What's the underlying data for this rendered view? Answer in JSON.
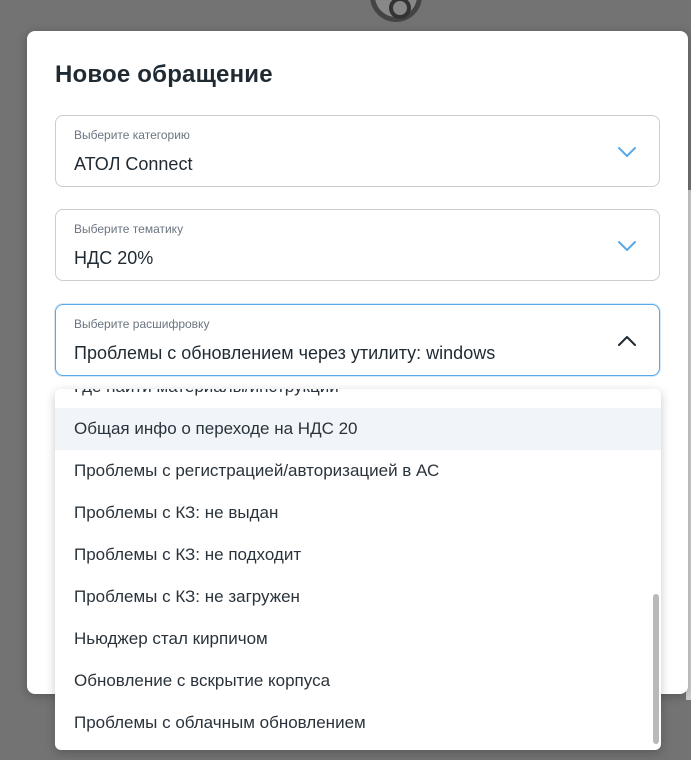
{
  "modal": {
    "title": "Новое обращение"
  },
  "fields": [
    {
      "label": "Выберите категорию",
      "value": "АТОЛ Connect",
      "icon": "chevron-down-icon"
    },
    {
      "label": "Выберите тематику",
      "value": "НДС 20%",
      "icon": "chevron-down-icon"
    },
    {
      "label": "Выберите расшифровку",
      "value": "Проблемы с  обновлением через утилиту: windows",
      "icon": "chevron-up-icon"
    }
  ],
  "options": [
    "Где найти материалы/инструкции",
    "Общая инфо о переходе на НДС 20",
    "Проблемы с регистрацией/авторизацией в АС",
    "Проблемы с КЗ: не выдан",
    "Проблемы с КЗ: не подходит",
    "Проблемы с КЗ: не загружен",
    "Ньюджер стал кирпичом",
    "Обновление с вскрытие корпуса",
    "Проблемы с облачным обновлением"
  ],
  "hovered_option_index": 1,
  "colors": {
    "accent": "#5aa9e6",
    "hover_background": "#f1f5fa",
    "text": "#1f2a33",
    "label": "#6b7580",
    "overlay": "#6f6f6f"
  }
}
